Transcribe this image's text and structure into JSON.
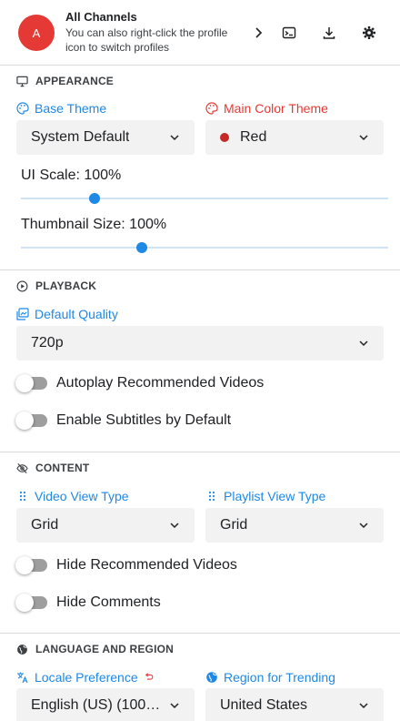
{
  "header": {
    "avatar_letter": "A",
    "profile_name": "All Channels",
    "profile_hint": "You can also right-click the profile icon to switch profiles",
    "buttons": [
      "chevron-right-icon",
      "terminal-icon",
      "download-icon",
      "gear-icon"
    ]
  },
  "appearance": {
    "title": "APPEARANCE",
    "base_theme_label": "Base Theme",
    "base_theme_value": "System Default",
    "main_color_label": "Main Color Theme",
    "main_color_value": "Red",
    "main_color_swatch": "#c62828",
    "ui_scale_label": "UI Scale: 100%",
    "ui_scale_fraction": 0.2,
    "thumb_size_label": "Thumbnail Size: 100%",
    "thumb_size_fraction": 0.33
  },
  "playback": {
    "title": "PLAYBACK",
    "default_quality_label": "Default Quality",
    "default_quality_value": "720p",
    "autoplay_label": "Autoplay Recommended Videos",
    "autoplay_on": false,
    "subtitles_label": "Enable Subtitles by Default",
    "subtitles_on": false
  },
  "content": {
    "title": "CONTENT",
    "video_view_label": "Video View Type",
    "video_view_value": "Grid",
    "playlist_view_label": "Playlist View Type",
    "playlist_view_value": "Grid",
    "hide_recommended_label": "Hide Recommended Videos",
    "hide_recommended_on": false,
    "hide_comments_label": "Hide Comments",
    "hide_comments_on": false
  },
  "language": {
    "title": "LANGUAGE AND REGION",
    "locale_label": "Locale Preference",
    "locale_value": "English (US) (100…",
    "region_label": "Region for Trending",
    "region_value": "United States"
  },
  "colors": {
    "accent": "#1e88e5",
    "avatar": "#e53935",
    "color_theme_label": "#e53935"
  }
}
